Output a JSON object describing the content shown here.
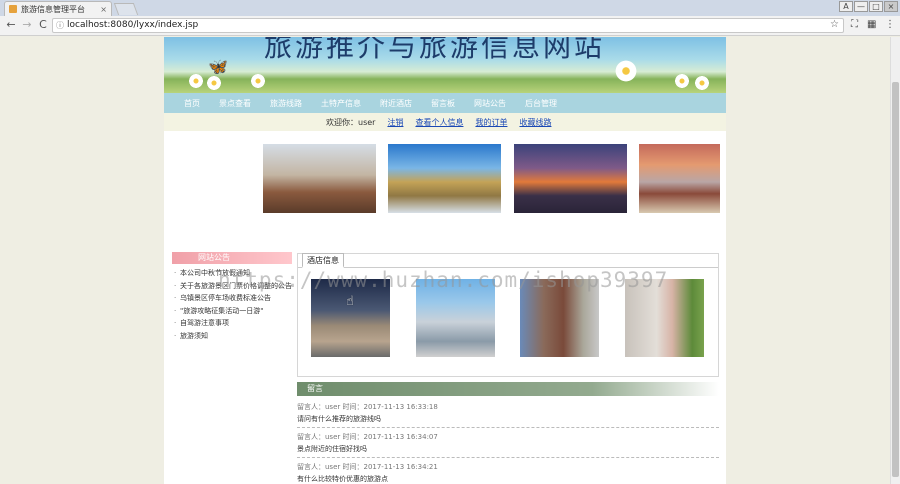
{
  "browser": {
    "tab_title": "旅游信息管理平台",
    "tab_close": "×",
    "url": "localhost:8080/lyxx/index.jsp",
    "back": "←",
    "forward": "→",
    "reload": "C",
    "info": "ⓘ",
    "star": "☆",
    "win_user": "A",
    "win_min": "—",
    "win_max": "□",
    "win_close": "×",
    "ext1": "⛶",
    "ext2": "▦",
    "menu": "⋮"
  },
  "banner": {
    "title": "旅游推介与旅游信息网站",
    "butterfly": "🦋"
  },
  "nav": {
    "items": [
      "首页",
      "景点查看",
      "旅游线路",
      "土特产信息",
      "附近酒店",
      "留言板",
      "网站公告",
      "后台管理"
    ]
  },
  "userbar": {
    "welcome": "欢迎你：user",
    "logout": "注销",
    "profile": "查看个人信息",
    "orders": "我的订单",
    "favorites": "收藏线路"
  },
  "watermark": "https://www.huzhan.com/ishop39397",
  "notice": {
    "title": "网站公告",
    "items": [
      "本公司中秋节放假通知",
      "关于各旅游景区门票价格调整的公告",
      "乌镇景区停车场收费标准公告",
      "\"旅游攻略征集活动一日游\"",
      "自驾游注意事项",
      "旅游须知"
    ]
  },
  "hotel": {
    "tab_label": "酒店信息",
    "cursor": "☝"
  },
  "messages": {
    "title": "留言",
    "items": [
      {
        "meta": "留言人：user    时间：2017-11-13 16:33:18",
        "body": "请问有什么推荐的旅游线吗"
      },
      {
        "meta": "留言人：user    时间：2017-11-13 16:34:07",
        "body": "景点附近的住宿好找吗"
      },
      {
        "meta": "留言人：user    时间：2017-11-13 16:34:21",
        "body": "有什么比较特价优惠的旅游点"
      }
    ]
  }
}
